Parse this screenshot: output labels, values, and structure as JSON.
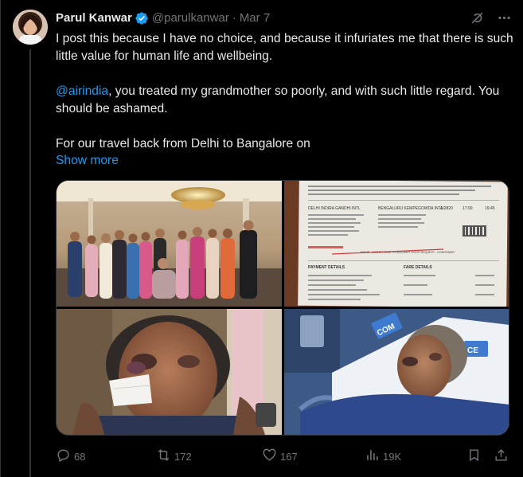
{
  "author": {
    "name": "Parul Kanwar",
    "handle": "@parulkanwar",
    "separator": "·",
    "date": "Mar 7"
  },
  "body": {
    "para1": "I post this because I have no choice, and because it infuriates me that there is such little value for human life and wellbeing.",
    "mention": "@airindia",
    "para2_rest": ", you treated my grandmother so poorly, and with such little regard. You should be ashamed.",
    "para3": "For our travel back from Delhi to Bangalore on",
    "show_more": "Show more"
  },
  "boarding_pass": {
    "from": "DELHI INDIRA GANDHI INTL",
    "to": "BENGALURU KEMPEGOWDA INTL",
    "flight": "AI2820",
    "dep_time": "17:00",
    "arr_time": "19:45",
    "payment_details": "PAYMENT DETAILS",
    "fare_details": "FARE DETAILS",
    "service_note": "WCHR - WHEELCHAIR TO AIRCRAFT DOOR REQUEST - CONFIRMED"
  },
  "hospital": {
    "sign_text_1": "COM",
    "sign_text_2": "CE"
  },
  "actions": {
    "replies": "68",
    "reposts": "172",
    "likes": "167",
    "views": "19K"
  },
  "colors": {
    "background": "#000000",
    "text": "#e7e9ea",
    "muted": "#71767b",
    "accent": "#1d9bf0",
    "border": "#2f3336"
  },
  "icons": [
    "verified-badge-icon",
    "grok-icon",
    "more-icon",
    "reply-icon",
    "repost-icon",
    "like-icon",
    "views-icon",
    "bookmark-icon",
    "share-icon"
  ]
}
